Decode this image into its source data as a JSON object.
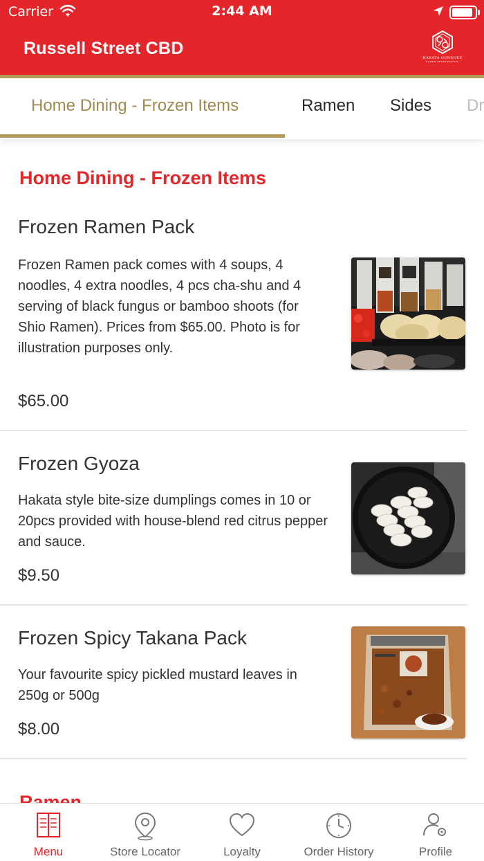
{
  "status_bar": {
    "carrier": "Carrier",
    "time": "2:44 AM",
    "battery_level": 0.9
  },
  "header": {
    "title": "Russell Street CBD",
    "logo_icon": "hakata-gensuke-logo",
    "logo_text": "HAKATA GENSUKE",
    "logo_subtext": "RAMEN PROFESSIONAL"
  },
  "tabs": [
    {
      "label": "Home Dining - Frozen Items",
      "active": true
    },
    {
      "label": "Ramen",
      "active": false
    },
    {
      "label": "Sides",
      "active": false
    },
    {
      "label": "Dr",
      "active": false
    }
  ],
  "sections": [
    {
      "title": "Home Dining - Frozen Items",
      "items": [
        {
          "name": "Frozen Ramen Pack",
          "description": "Frozen Ramen pack comes with 4 soups, 4 noodles, 4 extra noodles, 4 pcs cha-shu and 4 serving of black fungus or bamboo shoots (for Shio Ramen). Prices from $65.00. Photo is for illustration purposes only.",
          "price": "$65.00",
          "image": "ramen-pack-photo"
        },
        {
          "name": "Frozen Gyoza",
          "description": "Hakata style bite-size dumplings comes in 10 or 20pcs provided with house-blend red citrus pepper and sauce.",
          "price": "$9.50",
          "image": "gyoza-photo"
        },
        {
          "name": "Frozen Spicy Takana Pack",
          "description": "Your favourite spicy pickled mustard leaves in 250g or 500g",
          "price": "$8.00",
          "image": "takana-pack-photo"
        }
      ]
    },
    {
      "title": "Ramen"
    }
  ],
  "bottom_nav": [
    {
      "label": "Menu",
      "icon": "menu-book-icon",
      "active": true
    },
    {
      "label": "Store Locator",
      "icon": "location-pin-icon",
      "active": false
    },
    {
      "label": "Loyalty",
      "icon": "heart-icon",
      "active": false
    },
    {
      "label": "Order History",
      "icon": "clock-icon",
      "active": false
    },
    {
      "label": "Profile",
      "icon": "profile-settings-icon",
      "active": false
    }
  ],
  "colors": {
    "brand_red": "#e4262b",
    "accent_gold": "#b59a5a",
    "active_tab_text": "#a08a52"
  }
}
